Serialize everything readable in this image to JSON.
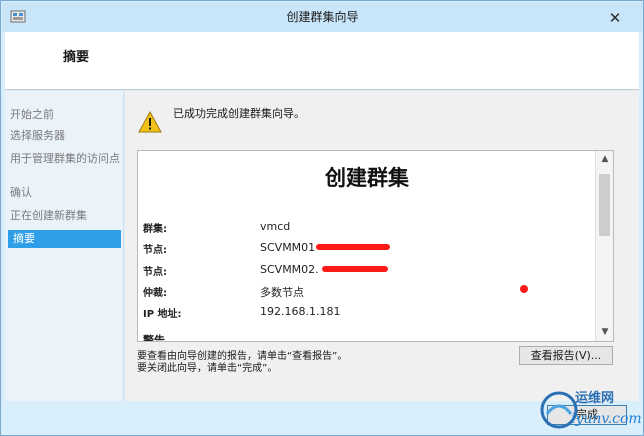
{
  "window": {
    "title": "创建群集向导"
  },
  "header": {
    "title": "摘要"
  },
  "sidebar": {
    "steps": [
      {
        "label": "开始之前"
      },
      {
        "label": "选择服务器"
      },
      {
        "label": "用于管理群集的访问点"
      },
      {
        "label": "确认"
      },
      {
        "label": "正在创建新群集"
      },
      {
        "label": "摘要"
      }
    ],
    "active_index": 5
  },
  "summary": {
    "message": "已成功完成创建群集向导。",
    "report": {
      "title": "创建群集",
      "rows": [
        {
          "label": "群集:",
          "value": "vmcd"
        },
        {
          "label": "节点:",
          "value": "SCVMM01"
        },
        {
          "label": "节点:",
          "value": "SCVMM02."
        },
        {
          "label": "仲裁:",
          "value": "多数节点"
        },
        {
          "label": "IP 地址:",
          "value": "192.168.1.181"
        }
      ],
      "cut_heading": "警告"
    },
    "help_line_1": "要查看由向导创建的报告，请单击“查看报告”。",
    "help_line_2": "要关闭此向导，请单击“完成”。",
    "view_report_label": "查看报告(V)..."
  },
  "footer": {
    "finish_label": "完成"
  },
  "watermark": {
    "text": "运维网",
    "url": "iyunv.com"
  },
  "colors": {
    "accent": "#2f9ee8",
    "redaction": "#ff1a1a",
    "titlebar": "#c9e5fa"
  }
}
